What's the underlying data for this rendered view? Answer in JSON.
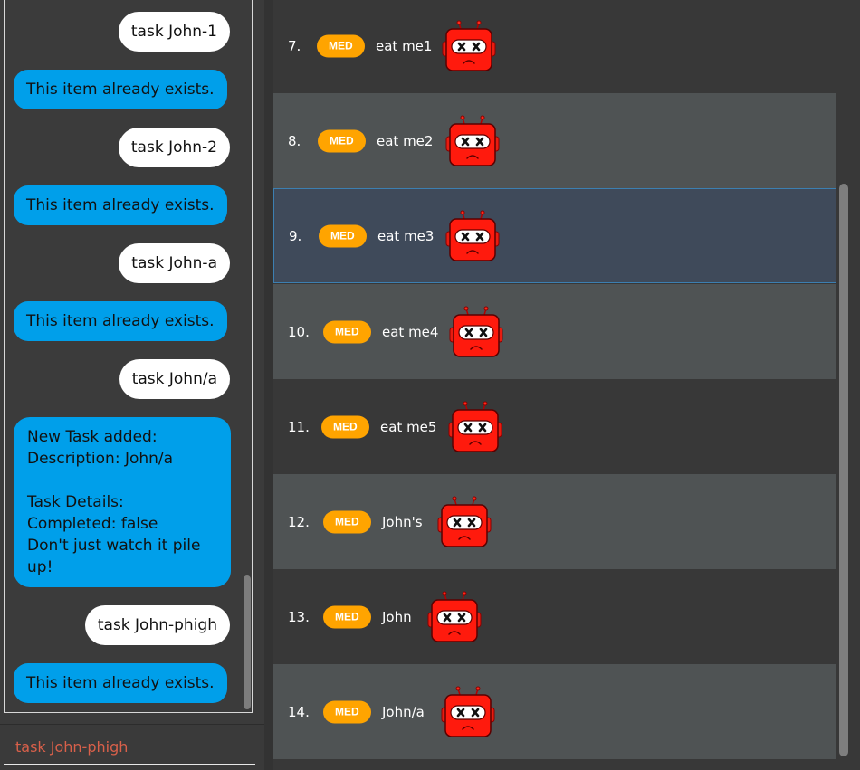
{
  "chat": {
    "messages": [
      {
        "role": "user",
        "text": "task John-1"
      },
      {
        "role": "bot",
        "text": "This item already exists."
      },
      {
        "role": "user",
        "text": "task John-2"
      },
      {
        "role": "bot",
        "text": "This item already exists."
      },
      {
        "role": "user",
        "text": "task John-a"
      },
      {
        "role": "bot",
        "text": "This item already exists."
      },
      {
        "role": "user",
        "text": "task John/a"
      },
      {
        "role": "bot",
        "text": "New Task added:\nDescription: John/a\n\nTask Details:\nCompleted: false\nDon't just watch it pile\nup!"
      },
      {
        "role": "user",
        "text": "task John-phigh"
      },
      {
        "role": "bot",
        "text": "This item already exists."
      }
    ]
  },
  "command_box": {
    "value": "task John-phigh"
  },
  "tasks": [
    {
      "index": "7.",
      "priority": "MED",
      "description": "eat me1",
      "icon": "sad-robot-icon"
    },
    {
      "index": "8.",
      "priority": "MED",
      "description": "eat me2",
      "icon": "sad-robot-icon"
    },
    {
      "index": "9.",
      "priority": "MED",
      "description": "eat me3",
      "icon": "sad-robot-icon"
    },
    {
      "index": "10.",
      "priority": "MED",
      "description": "eat me4",
      "icon": "sad-robot-icon"
    },
    {
      "index": "11.",
      "priority": "MED",
      "description": "eat me5",
      "icon": "sad-robot-icon"
    },
    {
      "index": "12.",
      "priority": "MED",
      "description": "John's",
      "icon": "sad-robot-icon"
    },
    {
      "index": "13.",
      "priority": "MED",
      "description": "John",
      "icon": "sad-robot-icon"
    },
    {
      "index": "14.",
      "priority": "MED",
      "description": "John/a",
      "icon": "sad-robot-icon"
    }
  ],
  "colors": {
    "user_bubble": "#ffffff",
    "bot_bubble": "#009fea",
    "priority_med": "#ffa400",
    "selected_row": "#3f4a5a",
    "command_text": "#d9604a"
  }
}
